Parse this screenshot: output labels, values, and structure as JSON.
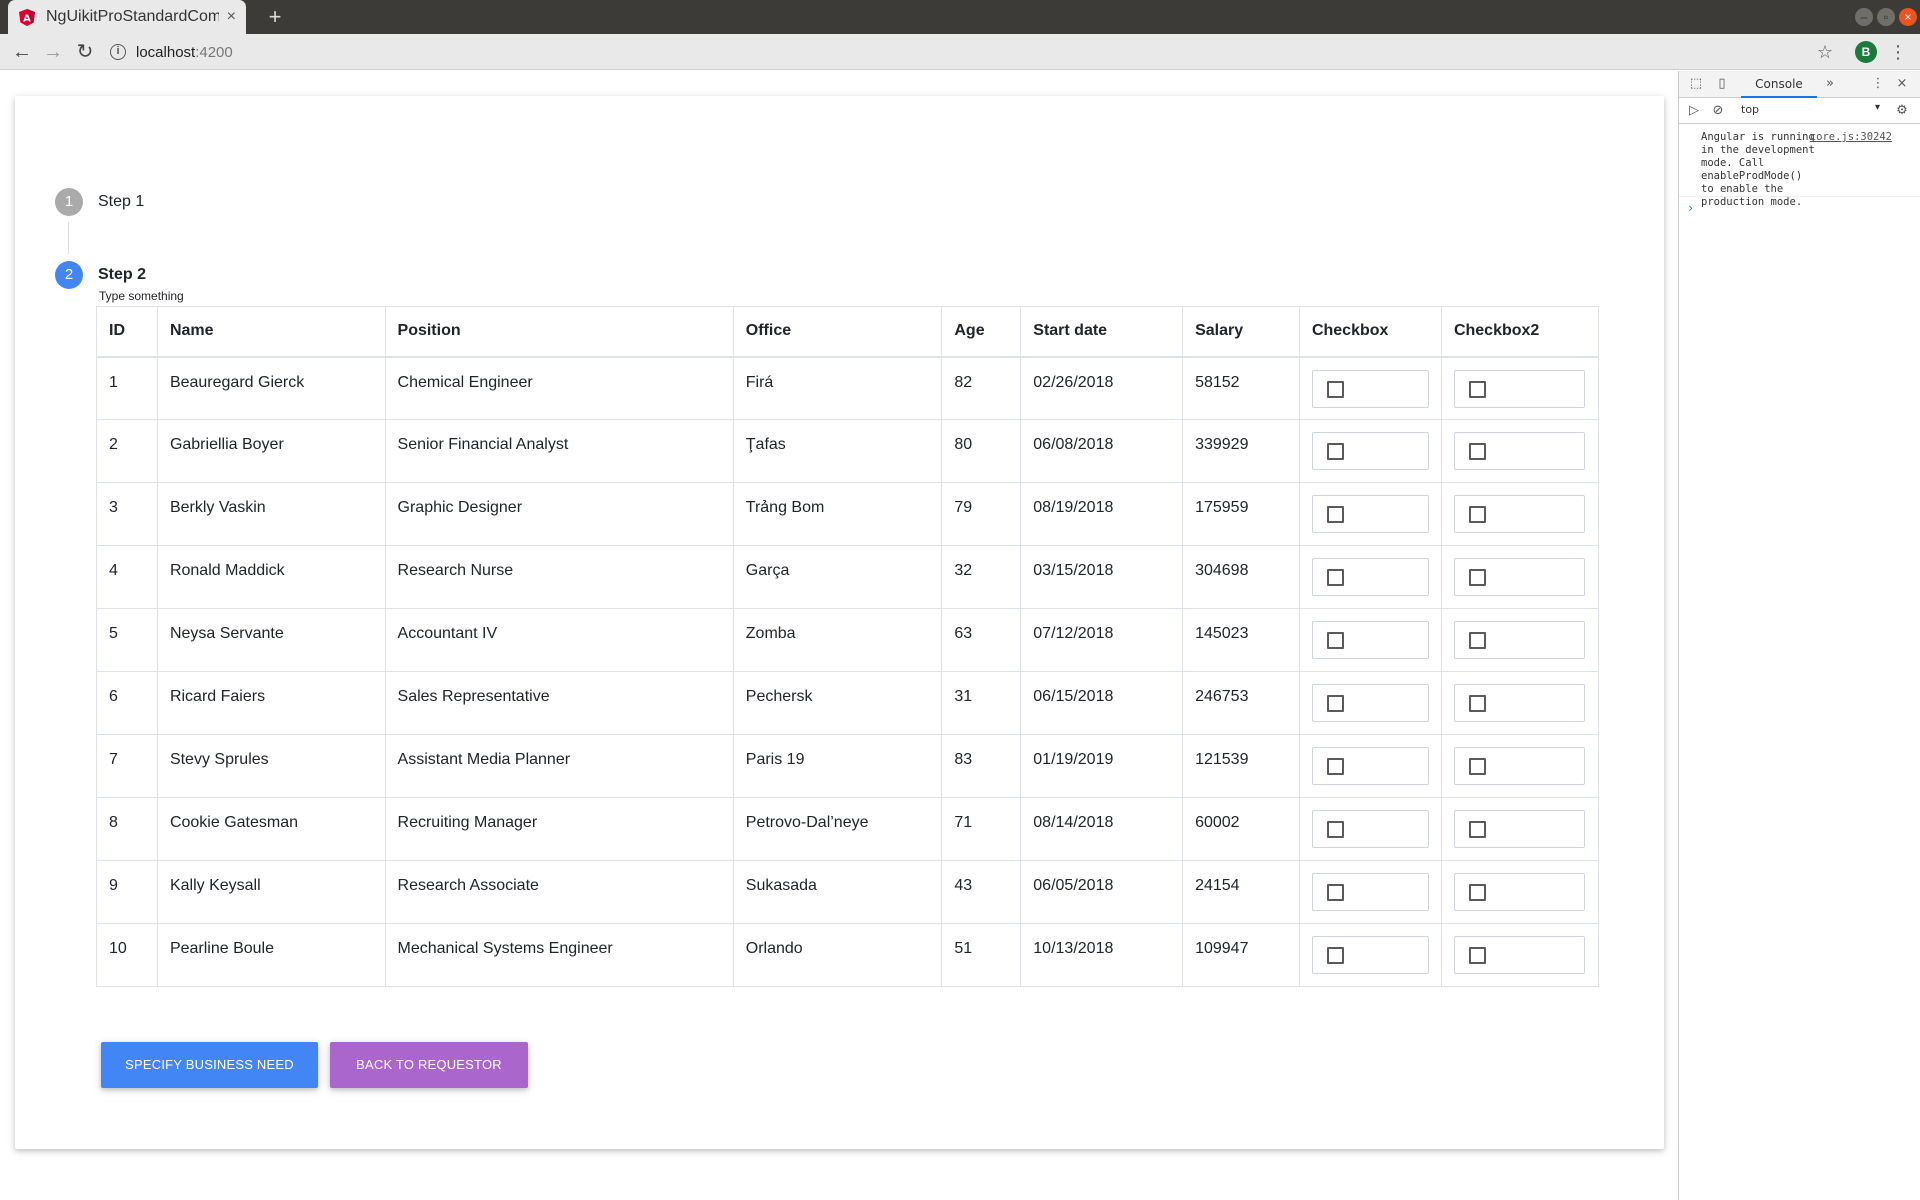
{
  "browser": {
    "tab_title": "NgUikitProStandardCom",
    "tab_close": "×",
    "new_tab": "+",
    "url_host": "localhost",
    "url_port": ":4200",
    "avatar_letter": "B",
    "icons": {
      "favicon": "angular-icon",
      "back": "back-arrow-icon",
      "forward": "forward-arrow-icon",
      "reload": "reload-icon",
      "info": "info-icon",
      "bookmark": "star-icon",
      "menu": "kebab-menu-icon"
    }
  },
  "stepper": {
    "step1": {
      "number": "1",
      "label": "Step 1"
    },
    "step2": {
      "number": "2",
      "label": "Step 2",
      "sublabel": "Type something"
    }
  },
  "table": {
    "headers": [
      "ID",
      "Name",
      "Position",
      "Office",
      "Age",
      "Start date",
      "Salary",
      "Checkbox",
      "Checkbox2"
    ],
    "rows": [
      {
        "id": "1",
        "name": "Beauregard Gierck",
        "position": "Chemical Engineer",
        "office": "Firá",
        "age": "82",
        "start": "02/26/2018",
        "salary": "58152"
      },
      {
        "id": "2",
        "name": "Gabriellia Boyer",
        "position": "Senior Financial Analyst",
        "office": "Ţafas",
        "age": "80",
        "start": "06/08/2018",
        "salary": "339929"
      },
      {
        "id": "3",
        "name": "Berkly Vaskin",
        "position": "Graphic Designer",
        "office": "Trảng Bom",
        "age": "79",
        "start": "08/19/2018",
        "salary": "175959"
      },
      {
        "id": "4",
        "name": "Ronald Maddick",
        "position": "Research Nurse",
        "office": "Garça",
        "age": "32",
        "start": "03/15/2018",
        "salary": "304698"
      },
      {
        "id": "5",
        "name": "Neysa Servante",
        "position": "Accountant IV",
        "office": "Zomba",
        "age": "63",
        "start": "07/12/2018",
        "salary": "145023"
      },
      {
        "id": "6",
        "name": "Ricard Faiers",
        "position": "Sales Representative",
        "office": "Pechersk",
        "age": "31",
        "start": "06/15/2018",
        "salary": "246753"
      },
      {
        "id": "7",
        "name": "Stevy Sprules",
        "position": "Assistant Media Planner",
        "office": "Paris 19",
        "age": "83",
        "start": "01/19/2019",
        "salary": "121539"
      },
      {
        "id": "8",
        "name": "Cookie Gatesman",
        "position": "Recruiting Manager",
        "office": "Petrovo-Dal’neye",
        "age": "71",
        "start": "08/14/2018",
        "salary": "60002"
      },
      {
        "id": "9",
        "name": "Kally Keysall",
        "position": "Research Associate",
        "office": "Sukasada",
        "age": "43",
        "start": "06/05/2018",
        "salary": "24154"
      },
      {
        "id": "10",
        "name": "Pearline Boule",
        "position": "Mechanical Systems Engineer",
        "office": "Orlando",
        "age": "51",
        "start": "10/13/2018",
        "salary": "109947"
      }
    ]
  },
  "buttons": {
    "primary": "Specify business need",
    "secondary": "Back to requestor",
    "primary_color": "#4285f4",
    "secondary_color": "#aa66cc"
  },
  "devtools": {
    "tab": "Console",
    "more": "»",
    "context": "top",
    "message": "Angular is running in the development mode. Call enableProdMode() to enable the production mode.",
    "source": "core.js:30242",
    "prompt": "›"
  }
}
